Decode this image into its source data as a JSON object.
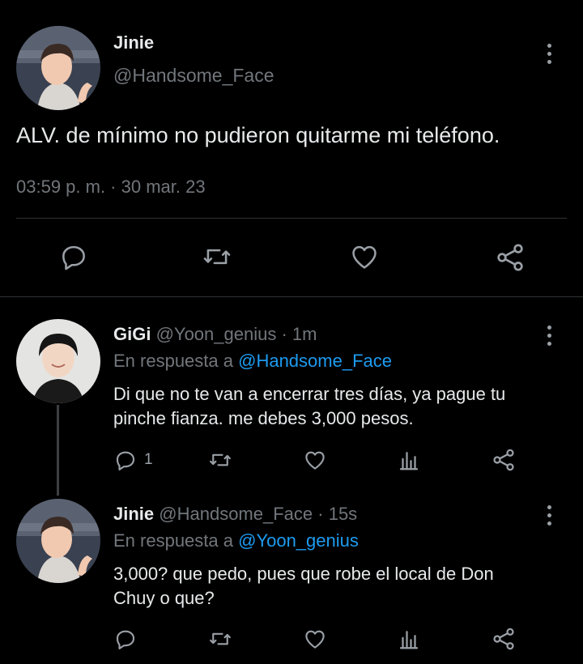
{
  "main_tweet": {
    "author_name": "Jinie",
    "author_handle": "@Handsome_Face",
    "text": "ALV. de mínimo no pudieron quitarme mi teléfono.",
    "timestamp": "03:59 p. m. · 30 mar. 23"
  },
  "replies": [
    {
      "author_name": "GiGi",
      "author_handle": "@Yoon_genius",
      "time": "· 1m",
      "reply_prefix": "En respuesta a",
      "reply_to": "@Handsome_Face",
      "text_line1": "Di que no te van a encerrar tres días, ya pague tu",
      "text_line2": "pinche fianza. me debes 3,000 pesos.",
      "reply_count": "1"
    },
    {
      "author_name": "Jinie",
      "author_handle": "@Handsome_Face",
      "time": "· 15s",
      "reply_prefix": "En respuesta a",
      "reply_to": "@Yoon_genius",
      "text_line1": "3,000? que pedo, pues que robe el local de Don",
      "text_line2": "Chuy o que?",
      "reply_count": ""
    }
  ],
  "icons": [
    "more-vertical-icon",
    "reply-icon",
    "retweet-icon",
    "like-icon",
    "share-icon",
    "analytics-icon"
  ],
  "colors": {
    "background": "#000000",
    "text": "#e7e9ea",
    "muted": "#71767b",
    "link": "#1d9bf0",
    "icon": "#9aa0a6"
  }
}
